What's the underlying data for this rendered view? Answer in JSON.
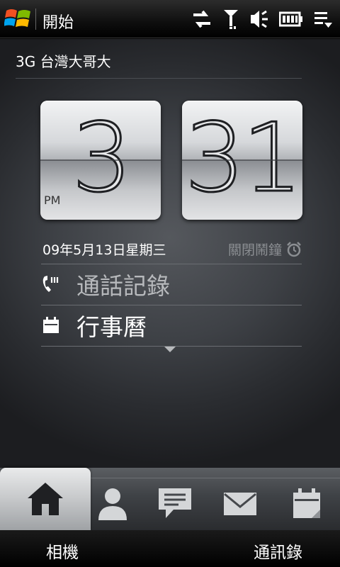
{
  "titlebar": {
    "title": "開始",
    "icons": [
      "windows-start-icon",
      "data-sync-icon",
      "signal-icon",
      "volume-icon",
      "battery-icon",
      "menu-icon"
    ]
  },
  "home": {
    "carrier": "3G 台灣大哥大",
    "clock": {
      "hour": "3",
      "minute": "31",
      "ampm": "PM"
    },
    "date": "09年5月13日星期三",
    "alarm": "關閉鬧鐘",
    "rows": [
      {
        "label": "通話記錄",
        "icon": "call-history-icon"
      },
      {
        "label": "行事曆",
        "icon": "calendar-icon"
      }
    ]
  },
  "tabs": [
    {
      "name": "home",
      "icon": "home-icon",
      "selected": true
    },
    {
      "name": "people",
      "icon": "person-icon"
    },
    {
      "name": "messages",
      "icon": "message-icon"
    },
    {
      "name": "mail",
      "icon": "mail-icon"
    },
    {
      "name": "calendar",
      "icon": "calendar-icon"
    }
  ],
  "softkeys": {
    "left": "相機",
    "right": "通訊錄"
  },
  "colors": {
    "accent_text": "#ffffff",
    "muted_text": "#b7b9bc",
    "alarm_text": "#8b8e92"
  }
}
